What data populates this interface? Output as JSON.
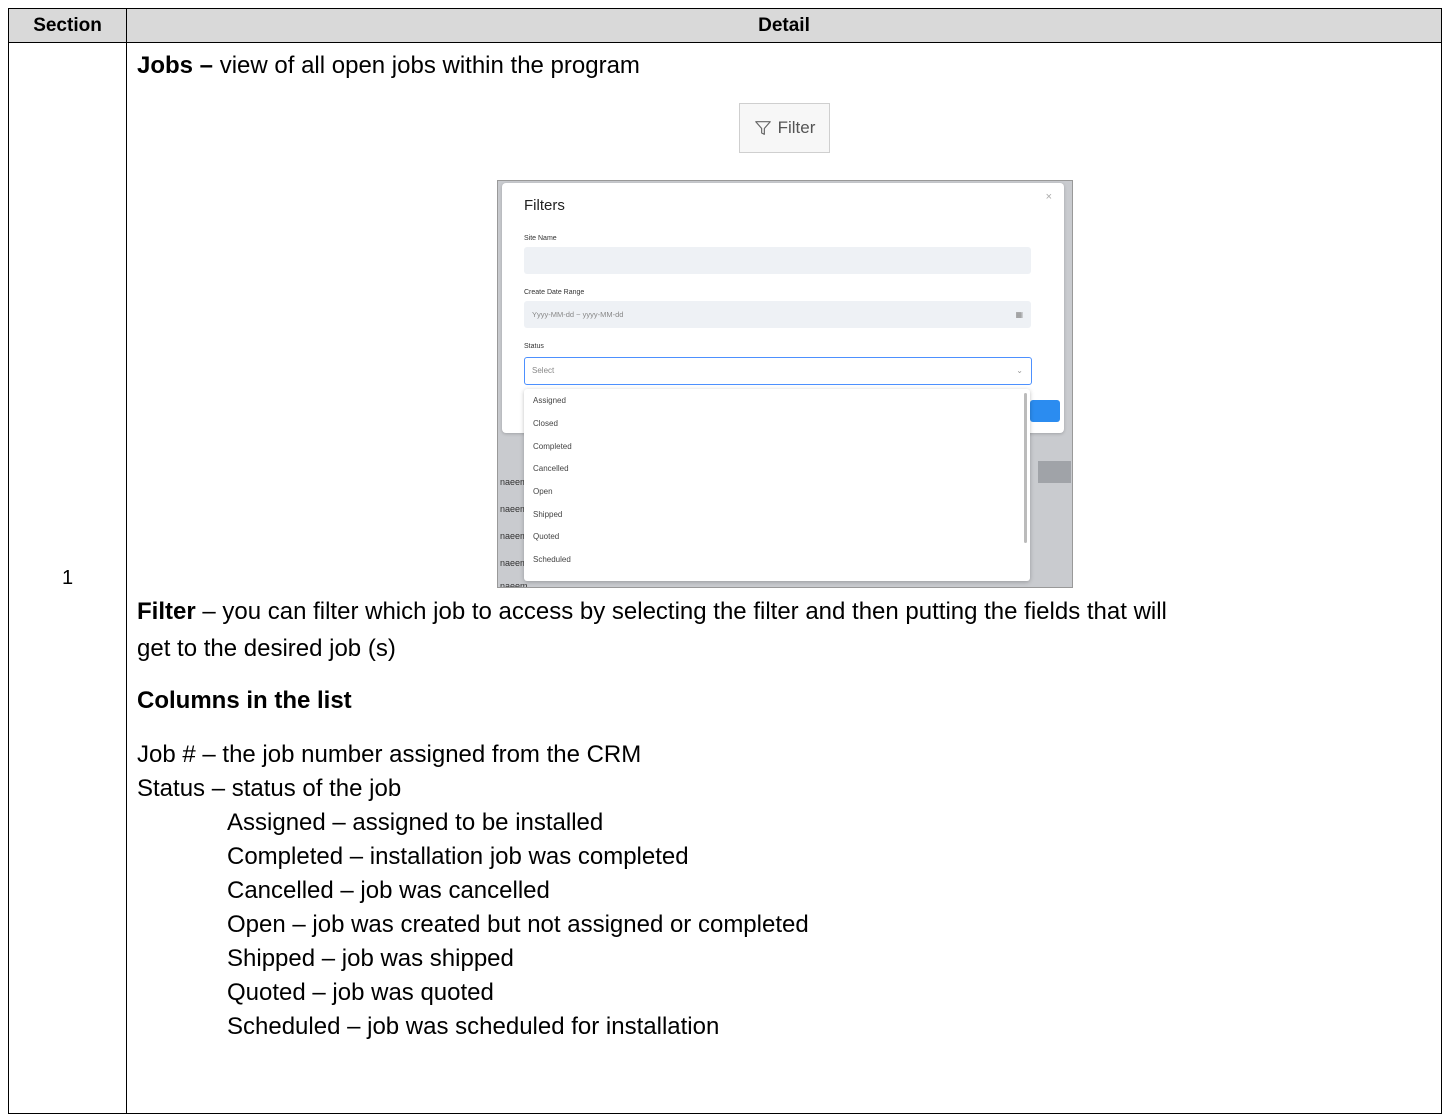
{
  "table": {
    "header_section": "Section",
    "header_detail": "Detail",
    "section_number": "1"
  },
  "detail": {
    "jobs_title": "Jobs –",
    "jobs_desc": " view of all open jobs within the program",
    "filter_title": "Filter",
    "filter_desc_1": " – you can filter which job to access by selecting the filter and then putting the fields that will",
    "filter_desc_2": "get to the desired job (s)",
    "columns_title": "Columns in the list",
    "job_num_line": "Job # – the job number assigned from the CRM",
    "status_line": "Status – status of the job",
    "statuses": [
      "Assigned – assigned to be installed",
      "Completed – installation job was completed",
      "Cancelled – job was cancelled",
      "Open – job was created but not assigned or completed",
      "Shipped – job was shipped",
      "Quoted – job was quoted",
      "Scheduled – job was scheduled for installation"
    ]
  },
  "filter_button": {
    "label": "Filter",
    "icon": "funnel-icon"
  },
  "filter_modal": {
    "title": "Filters",
    "close": "×",
    "site_name_label": "Site Name",
    "date_range_label": "Create Date Range",
    "date_range_placeholder": "Yyyy-MM-dd ~ yyyy-MM-dd",
    "status_label": "Status",
    "status_placeholder": "Select",
    "options": [
      "Assigned",
      "Closed",
      "Completed",
      "Cancelled",
      "Open",
      "Shipped",
      "Quoted",
      "Scheduled"
    ],
    "background_rows": [
      "naeem",
      "naeem",
      "naeem",
      "naeem",
      "naeem"
    ]
  },
  "colors": {
    "header_bg": "#d9d9d9",
    "primary": "#2b8cf0"
  }
}
